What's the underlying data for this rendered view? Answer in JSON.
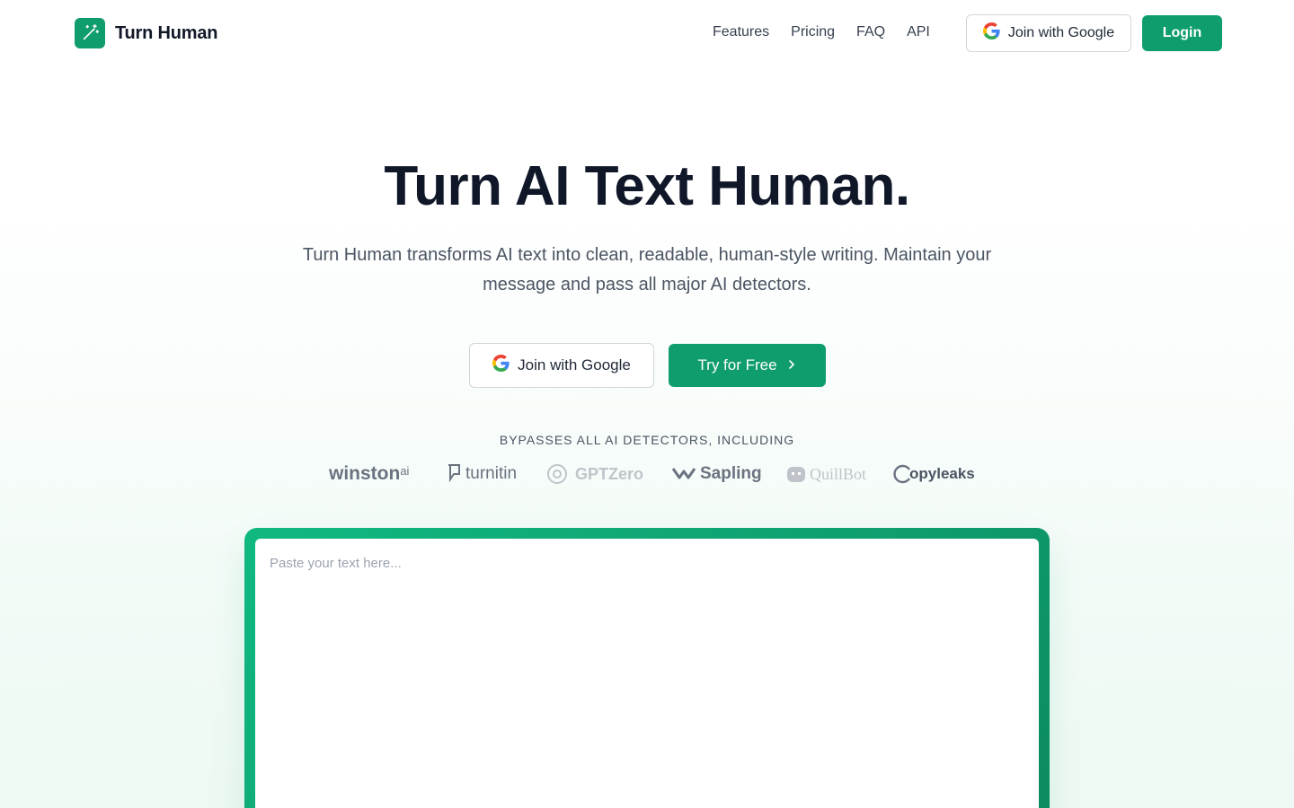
{
  "brand": {
    "name": "Turn Human",
    "accent": "#0f9d6e"
  },
  "nav": {
    "items": [
      "Features",
      "Pricing",
      "FAQ",
      "API"
    ]
  },
  "header": {
    "google_button": "Join with Google",
    "login_button": "Login"
  },
  "hero": {
    "title": "Turn AI Text Human.",
    "subtitle": "Turn Human transforms AI text into clean, readable, human-style writing. Maintain your message and pass all major AI detectors.",
    "google_button": "Join with Google",
    "try_button": "Try for Free"
  },
  "detectors": {
    "heading": "BYPASSES ALL AI DETECTORS, INCLUDING",
    "logos": [
      {
        "name": "winston",
        "suffix": "ai",
        "icon": "winston-logo"
      },
      {
        "name": "turnitin",
        "icon": "turnitin-logo"
      },
      {
        "name": "GPTZero",
        "icon": "gptzero-logo"
      },
      {
        "name": "Sapling",
        "icon": "sapling-logo"
      },
      {
        "name": "QuillBot",
        "icon": "quillbot-logo"
      },
      {
        "name": "opyleaks",
        "icon": "copyleaks-logo"
      }
    ]
  },
  "editor": {
    "placeholder": "Paste your text here..."
  }
}
